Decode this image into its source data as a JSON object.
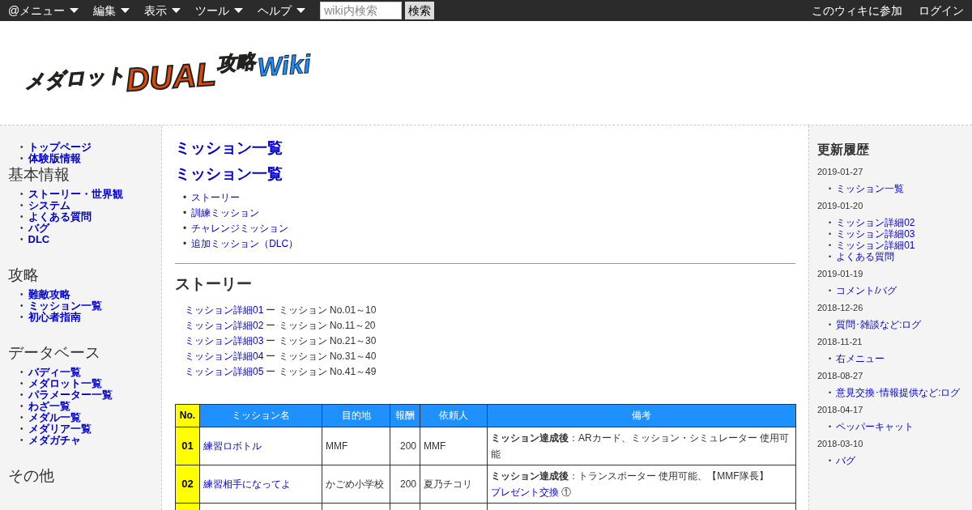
{
  "topbar": {
    "menus": [
      {
        "label": "@メニュー"
      },
      {
        "label": "編集"
      },
      {
        "label": "表示"
      },
      {
        "label": "ツール"
      },
      {
        "label": "ヘルプ"
      }
    ],
    "search": {
      "placeholder": "wiki内検索",
      "button": "検索"
    },
    "right_links": [
      "このウィキに参加",
      "ログイン"
    ]
  },
  "logo": {
    "parts": [
      {
        "kind": "small",
        "text": "メダロット"
      },
      {
        "kind": "big",
        "text": "DUAL"
      },
      {
        "kind": "gold",
        "text": "攻略"
      },
      {
        "kind": "blue",
        "text": "Wiki"
      }
    ]
  },
  "left_sidebar": {
    "sections": [
      {
        "items": [
          "トップページ",
          "体験版情報"
        ]
      },
      {
        "heading": "基本情報",
        "items": [
          "ストーリー・世界観",
          "システム",
          "よくある質問",
          "バグ",
          "DLC"
        ]
      },
      {
        "heading": "攻略",
        "items": [
          "難敵攻略",
          "ミッション一覧",
          "初心者指南"
        ]
      },
      {
        "heading": "データベース",
        "items": [
          "バディ一覧",
          "メダロット一覧",
          "パラメーター一覧",
          "わざ一覧",
          "メダル一覧",
          "メダリア一覧",
          "メダガチャ"
        ]
      },
      {
        "heading": "その他"
      }
    ]
  },
  "bullet": "•",
  "main": {
    "page_title": "ミッション一覧",
    "heading": "ミッション一覧",
    "toc": [
      "ストーリー",
      "訓練ミッション",
      "チャレンジミッション",
      "追加ミッション（DLC）"
    ],
    "section_title": "ストーリー",
    "story_links": [
      {
        "link": "ミッション詳細01",
        "text": "ー ミッション No.01～10"
      },
      {
        "link": "ミッション詳細02",
        "text": "ー ミッション No.11～20"
      },
      {
        "link": "ミッション詳細03",
        "text": "ー ミッション No.21～30"
      },
      {
        "link": "ミッション詳細04",
        "text": "ー ミッション No.31～40"
      },
      {
        "link": "ミッション詳細05",
        "text": "ー ミッション No.41～49"
      }
    ],
    "table": {
      "columns": [
        "No.",
        "ミッション名",
        "目的地",
        "報酬",
        "依頼人",
        "備考"
      ],
      "rows": [
        {
          "no": "01",
          "name": "練習ロボトル",
          "destination": "MMF",
          "reward": "200",
          "client": "MMF",
          "note": "**ミッション達成後**：ARカード、ミッション・シミュレーター 使用可能"
        },
        {
          "no": "02",
          "name": "練習相手になってよ",
          "destination": "かごめ小学校",
          "reward": "200",
          "client": "夏乃チコリ",
          "note": "**ミッション達成後**：トランスポーター 使用可能、【MMF隊長】",
          "note_link": "プレゼント交換",
          "note_after": " ①"
        },
        {
          "cut_off": true
        }
      ]
    }
  },
  "right_sidebar": {
    "heading": "更新履歴",
    "days": [
      {
        "date": "2019-01-27",
        "items": [
          "ミッション一覧"
        ]
      },
      {
        "date": "2019-01-20",
        "items": [
          "ミッション詳細02",
          "ミッション詳細03",
          "ミッション詳細01",
          "よくある質問"
        ]
      },
      {
        "date": "2019-01-19",
        "items": [
          "コメント/バグ"
        ]
      },
      {
        "date": "2018-12-26",
        "items": [
          "質問･雑談など:ログ"
        ]
      },
      {
        "date": "2018-11-21",
        "items": [
          "右メニュー"
        ]
      },
      {
        "date": "2018-08-27",
        "items": [
          "意見交換･情報提供など:ログ"
        ]
      },
      {
        "date": "2018-04-17",
        "items": [
          "ペッパーキャット"
        ]
      },
      {
        "date": "2018-03-10",
        "items": [
          "バグ"
        ]
      }
    ]
  }
}
